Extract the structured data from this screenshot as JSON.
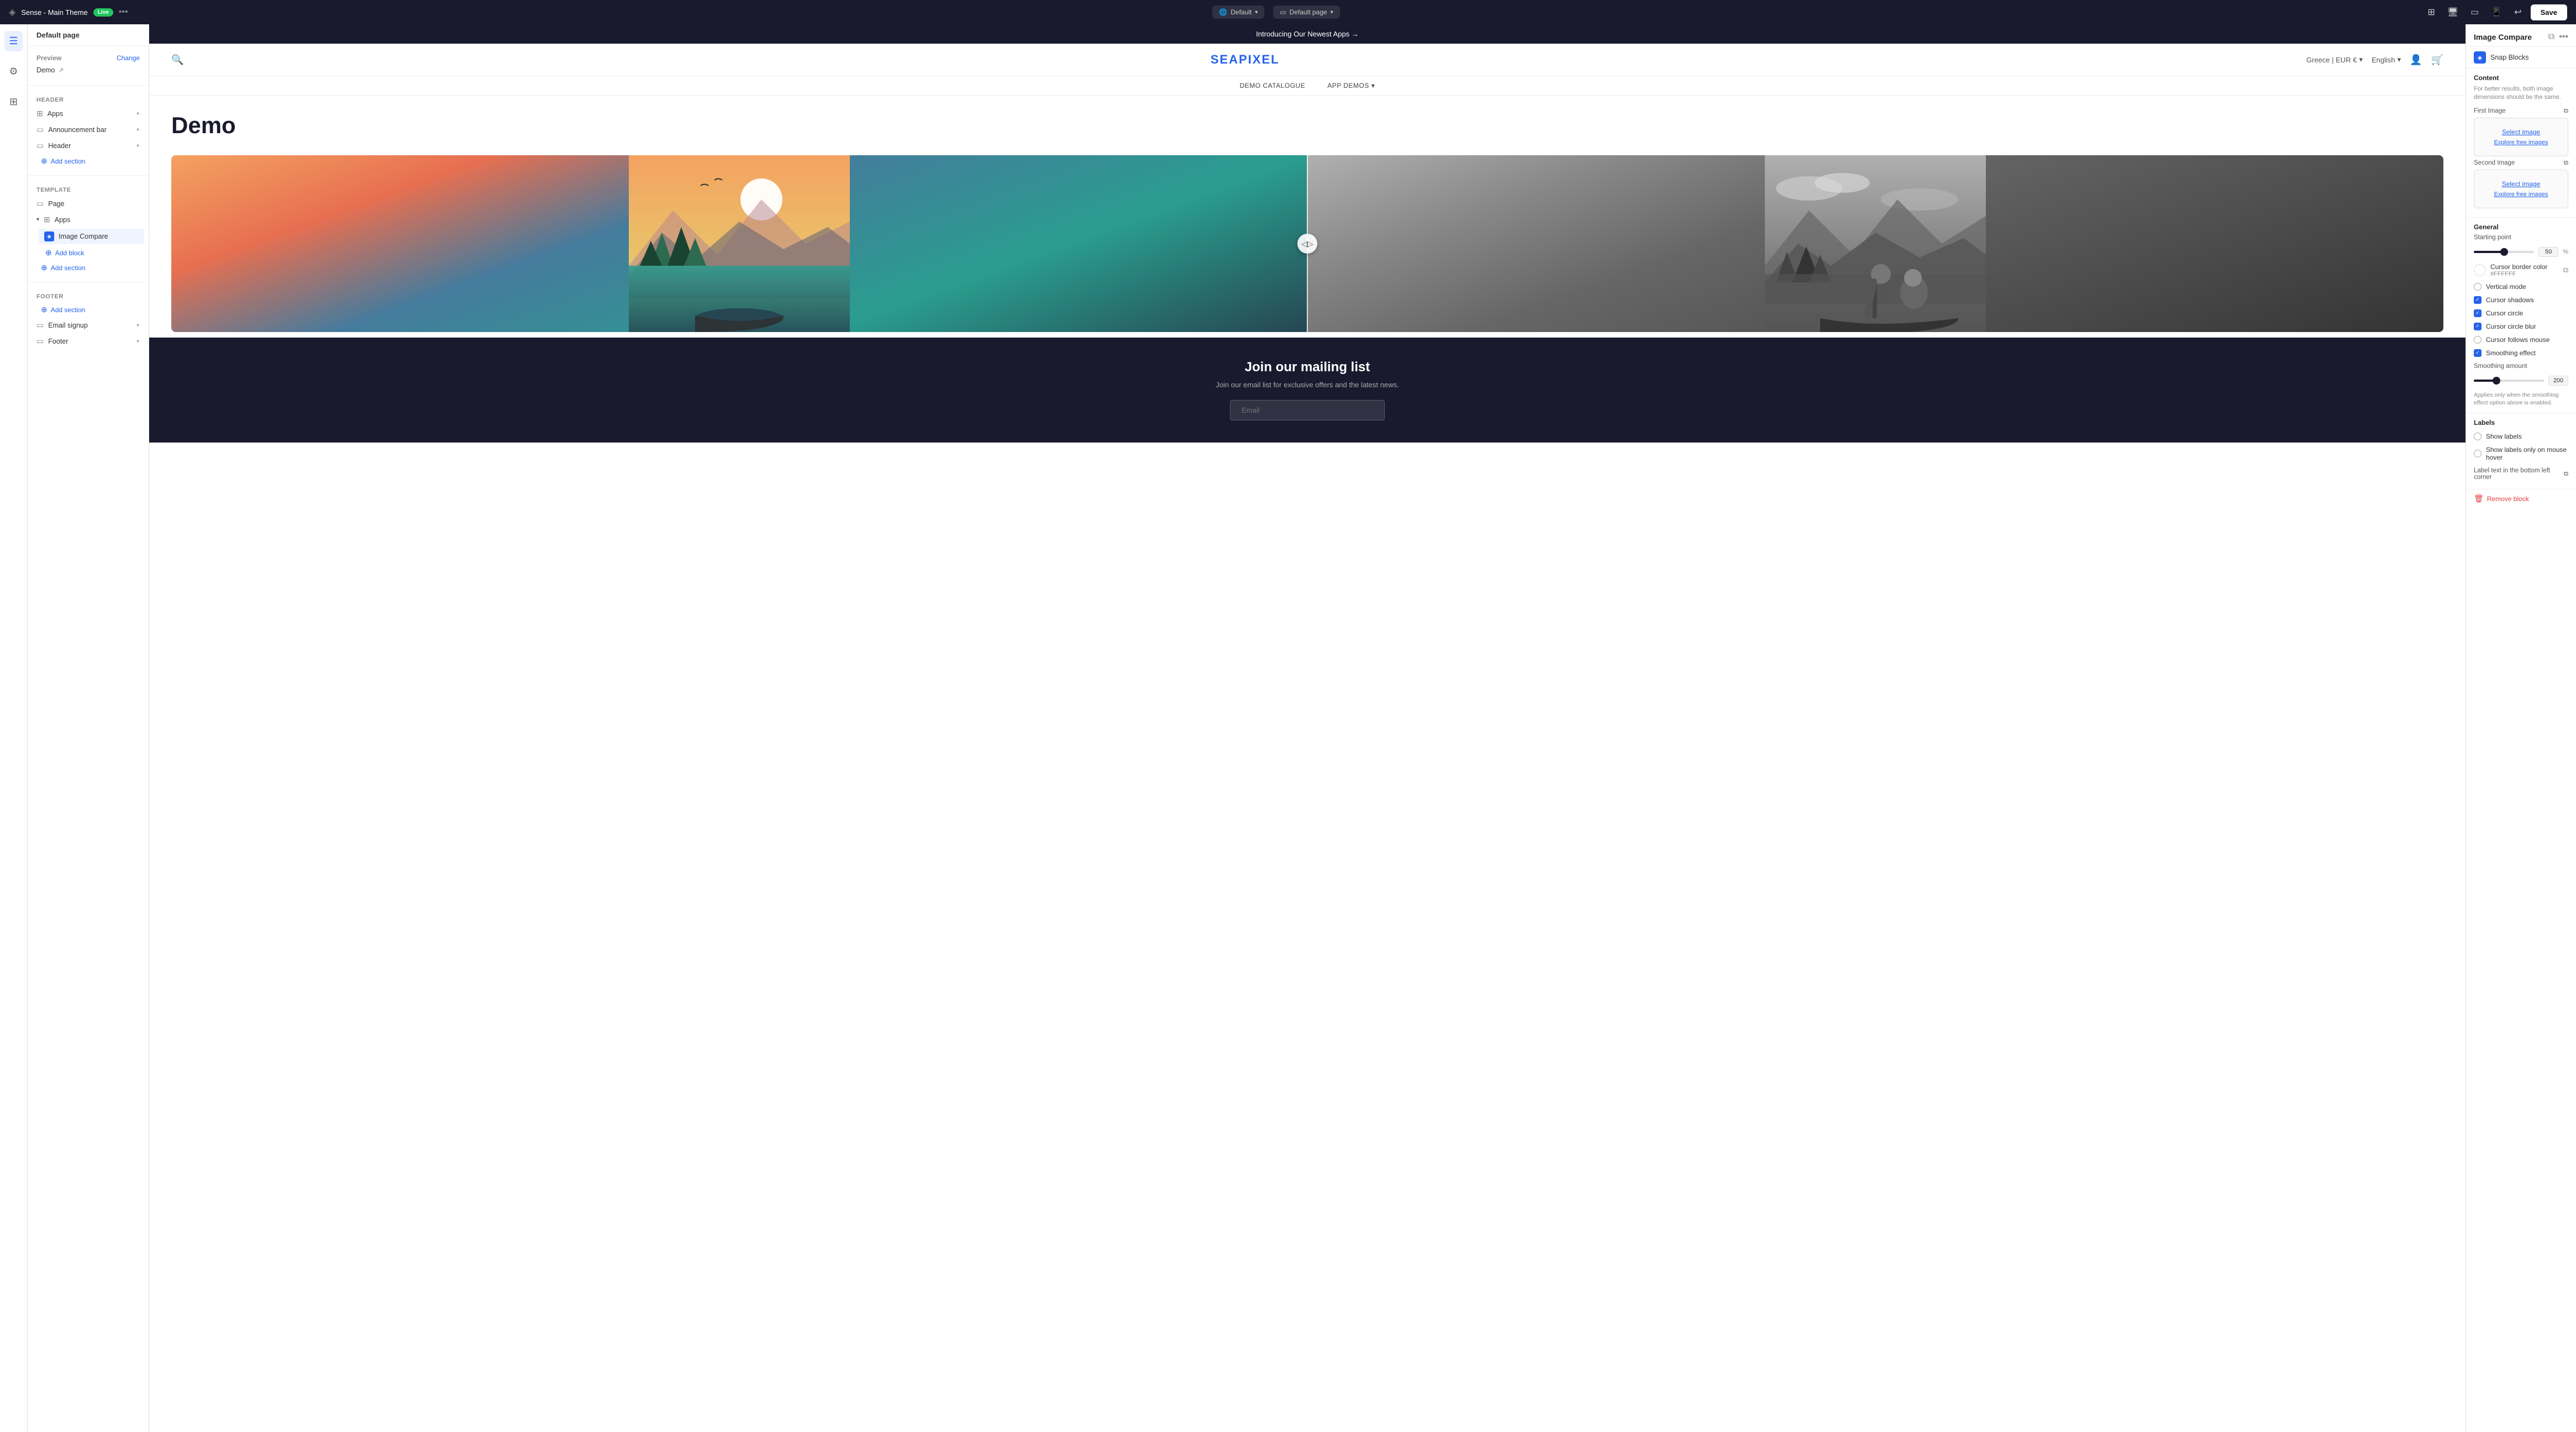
{
  "topbar": {
    "theme_name": "Sense - Main Theme",
    "live_label": "Live",
    "more_label": "•••",
    "globe_icon": "🌐",
    "default_label": "Default",
    "default_page_label": "Default page",
    "undo_icon": "↩",
    "icons": [
      "⊞",
      "□",
      "◻",
      "▦"
    ],
    "save_label": "Save"
  },
  "left_panel": {
    "header": "Default page",
    "preview": {
      "label": "Preview",
      "change_label": "Change",
      "demo_label": "Demo",
      "external_icon": "↗"
    },
    "sections": [
      {
        "title": "Header",
        "items": [
          {
            "label": "Apps",
            "icon": "⊞",
            "expandable": true
          },
          {
            "label": "Announcement bar",
            "icon": "▭",
            "expandable": true
          },
          {
            "label": "Header",
            "icon": "▭",
            "expandable": true
          }
        ],
        "add_section": "Add section"
      },
      {
        "title": "Template",
        "items": [
          {
            "label": "Page",
            "icon": "▭"
          },
          {
            "label": "Apps",
            "icon": "⊞",
            "expanded": true,
            "children": [
              {
                "label": "Image Compare"
              }
            ]
          }
        ],
        "add_block": "Add block",
        "add_section": "Add section"
      },
      {
        "title": "Footer",
        "items": [
          {
            "label": "Email signup",
            "icon": "▭",
            "expandable": true
          },
          {
            "label": "Footer",
            "icon": "▭",
            "expandable": true
          }
        ],
        "add_section": "Add section"
      }
    ]
  },
  "store": {
    "announcement": "Introducing Our Newest Apps →",
    "search_icon": "🔍",
    "logo": "SEAPIXEL",
    "nav_right": {
      "location": "Greece | EUR €",
      "language": "English",
      "account_icon": "👤",
      "cart_icon": "🛒"
    },
    "menu": [
      {
        "label": "DEMO CATALOGUE"
      },
      {
        "label": "APP DEMOS",
        "has_arrow": true
      }
    ],
    "demo_title": "Demo",
    "mailing": {
      "title": "Join our mailing list",
      "subtitle": "Join our email list for exclusive offers and the latest news.",
      "email_placeholder": "Email"
    }
  },
  "right_panel": {
    "title": "Image Compare",
    "copy_icon": "⧉",
    "more_icon": "•••",
    "provider": "Snap Blocks",
    "content": {
      "title": "Content",
      "note": "For better results, both image dimensions should be the same.",
      "first_image_label": "First Image",
      "second_image_label": "Second Image",
      "select_image": "Select image",
      "explore_free": "Explore free images"
    },
    "general": {
      "title": "General",
      "starting_point_label": "Starting point",
      "starting_point_value": "50",
      "starting_point_unit": "%",
      "cursor_border_color_label": "Cursor border color",
      "cursor_border_color_value": "#FFFFFF",
      "cursor_border_color_hex": "#ffffff",
      "vertical_mode_label": "Vertical mode",
      "cursor_shadows_label": "Cursor shadows",
      "cursor_circle_label": "Cursor circle",
      "cursor_circle_blur_label": "Cursor circle blur",
      "cursor_follows_mouse_label": "Cursor follows mouse",
      "smoothing_effect_label": "Smoothing effect",
      "smoothing_amount_label": "Smoothing amount",
      "smoothing_amount_value": "200",
      "smoothing_note": "Applies only when the smoothing effect option above is enabled."
    },
    "labels": {
      "title": "Labels",
      "show_labels": "Show labels",
      "show_labels_only_hover": "Show labels only on mouse hover",
      "label_bottom_left": "Label text in the bottom left corner",
      "label_icon": "⧉"
    },
    "remove_block": "Remove block"
  }
}
